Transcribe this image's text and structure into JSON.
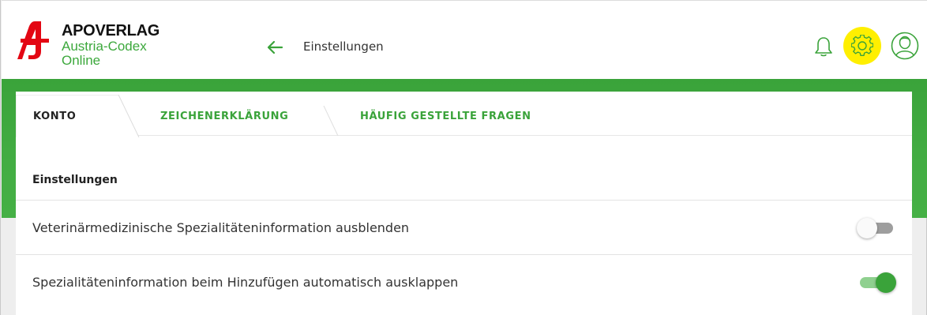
{
  "header": {
    "brand_name": "APOVERLAG",
    "brand_sub_line1": "Austria-Codex",
    "brand_sub_line2": "Online",
    "page_title": "Einstellungen",
    "back_icon": "arrow-left-icon",
    "notification_icon": "bell-icon",
    "settings_icon": "gear-icon",
    "profile_icon": "user-avatar-icon"
  },
  "tabs": [
    {
      "label": "KONTO",
      "active": true
    },
    {
      "label": "ZEICHENERKLÄRUNG",
      "active": false
    },
    {
      "label": "HÄUFIG GESTELLTE FRAGEN",
      "active": false
    }
  ],
  "settings": {
    "section_title": "Einstellungen",
    "rows": [
      {
        "label": "Veterinärmedizinische Spezialitäteninformation ausblenden",
        "enabled": false
      },
      {
        "label": "Spezialitäteninformation beim Hinzufügen automatisch ausklappen",
        "enabled": true
      }
    ]
  },
  "colors": {
    "brand_red": "#e30613",
    "accent_green": "#3aa33a",
    "highlight_yellow": "#ffef00"
  }
}
